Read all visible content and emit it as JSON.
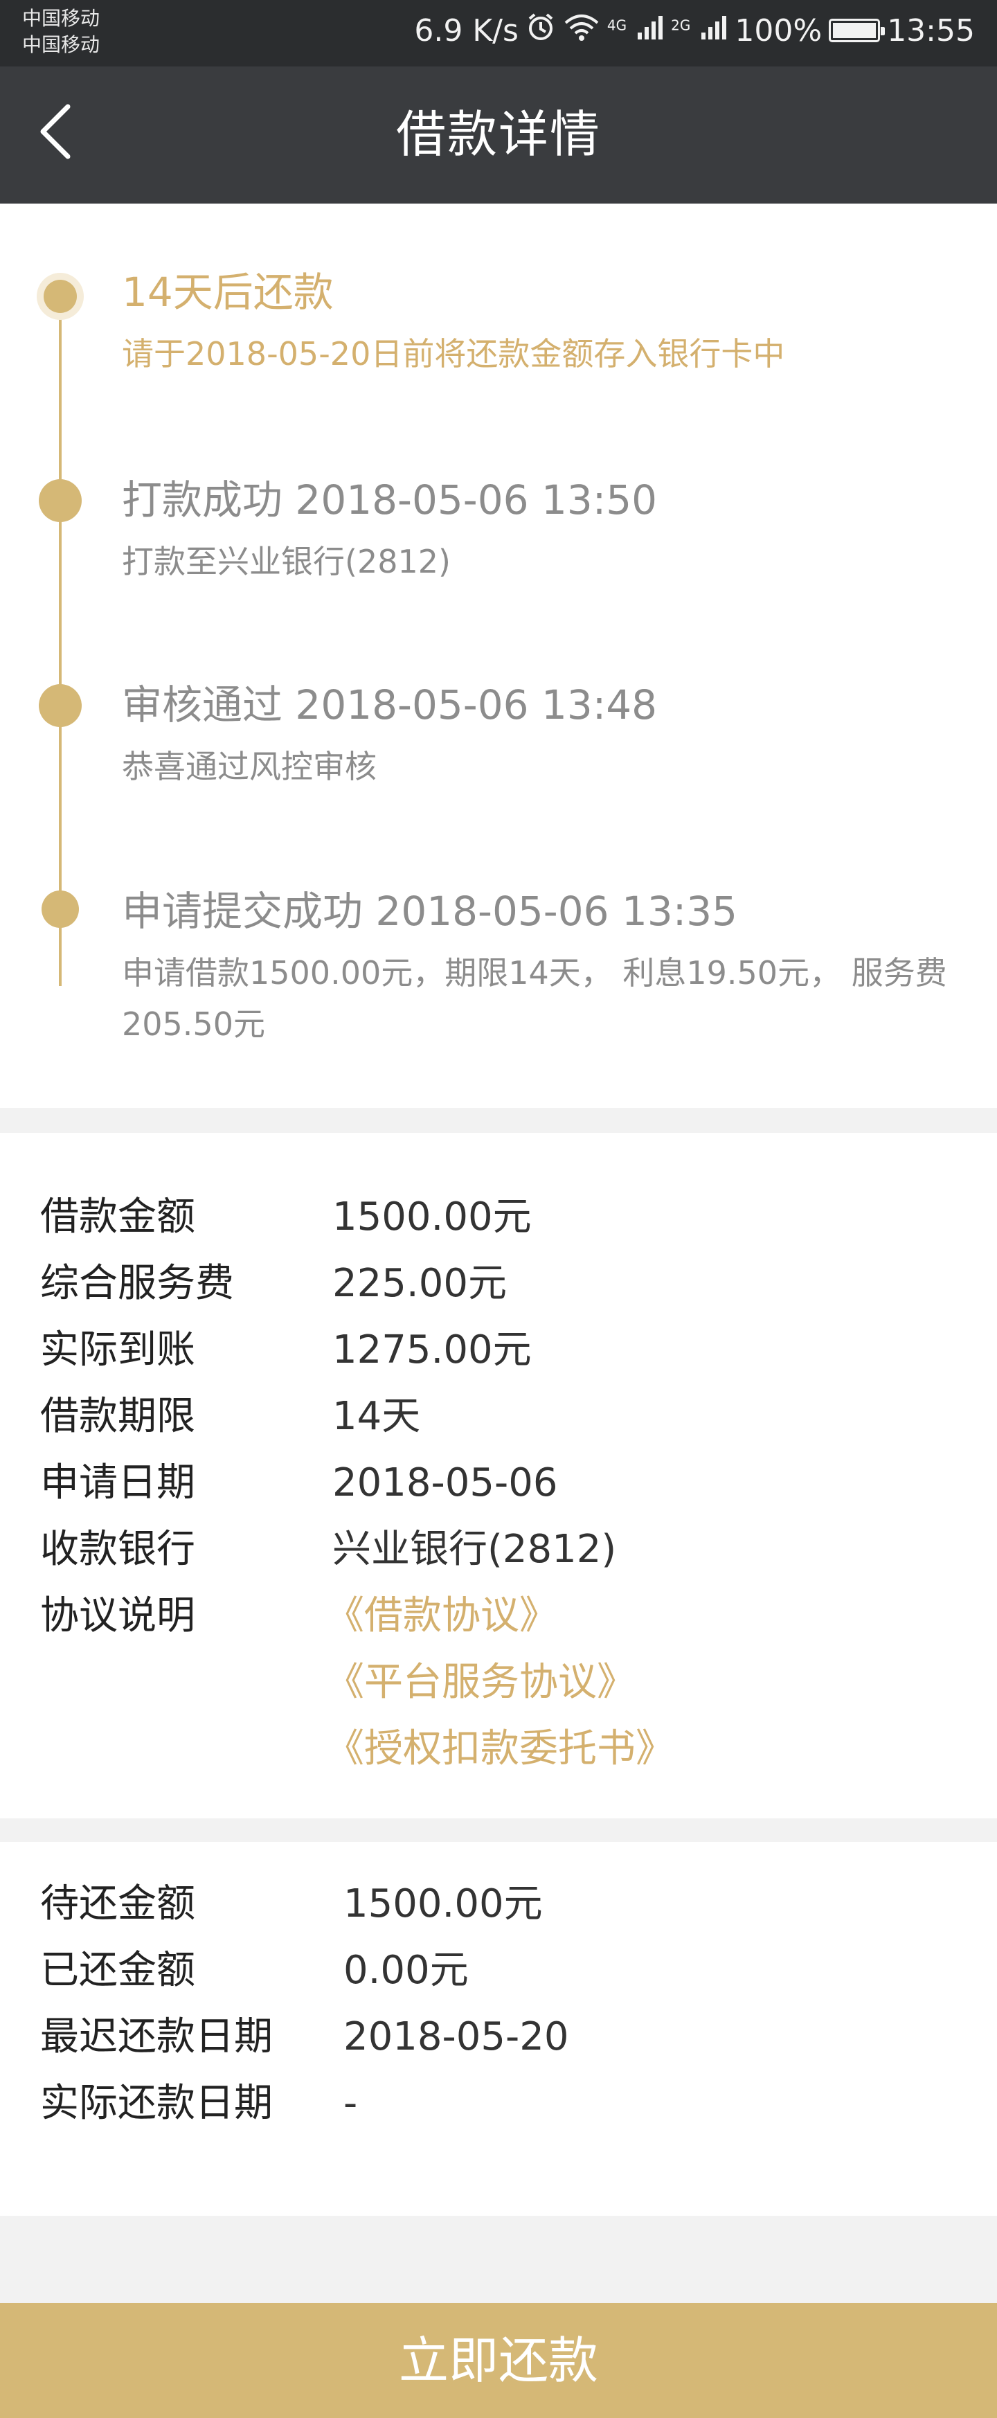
{
  "status_bar": {
    "carrier_1": "中国移动",
    "carrier_2": "中国移动",
    "speed": "6.9 K/s",
    "net_4g": "4G",
    "net_2g": "2G",
    "battery": "100%",
    "time": "13:55",
    "icons": [
      "alarm-icon",
      "wifi-icon",
      "signal-icon",
      "signal-icon",
      "battery-icon"
    ]
  },
  "nav": {
    "title": "借款详情",
    "back_icon": "chevron-left-icon"
  },
  "timeline": [
    {
      "title": "14天后还款",
      "desc": "请于2018-05-20日前将还款金额存入银行卡中"
    },
    {
      "title": "打款成功 2018-05-06 13:50",
      "desc": "打款至兴业银行(2812)"
    },
    {
      "title": "审核通过 2018-05-06 13:48",
      "desc": "恭喜通过风控审核"
    },
    {
      "title": "申请提交成功 2018-05-06 13:35",
      "desc": "申请借款1500.00元，期限14天， 利息19.50元， 服务费205.50元"
    }
  ],
  "loan_info": {
    "amount_label": "借款金额",
    "amount": "1500.00元",
    "fee_label": "综合服务费",
    "fee": "225.00元",
    "received_label": "实际到账",
    "received": "1275.00元",
    "term_label": "借款期限",
    "term": "14天",
    "date_label": "申请日期",
    "date": "2018-05-06",
    "bank_label": "收款银行",
    "bank": "兴业银行(2812)",
    "agreement_label": "协议说明",
    "agreements": [
      "《借款协议》",
      "《平台服务协议》",
      "《授权扣款委托书》"
    ]
  },
  "repayment": {
    "pending_label": "待还金额",
    "pending": "1500.00元",
    "paid_label": "已还金额",
    "paid": "0.00元",
    "latest_label": "最迟还款日期",
    "latest": "2018-05-20",
    "actual_label": "实际还款日期",
    "actual": "-"
  },
  "pay_button": "立即还款",
  "colors": {
    "gold": "#d4b06e",
    "header": "#3a3c3f"
  }
}
